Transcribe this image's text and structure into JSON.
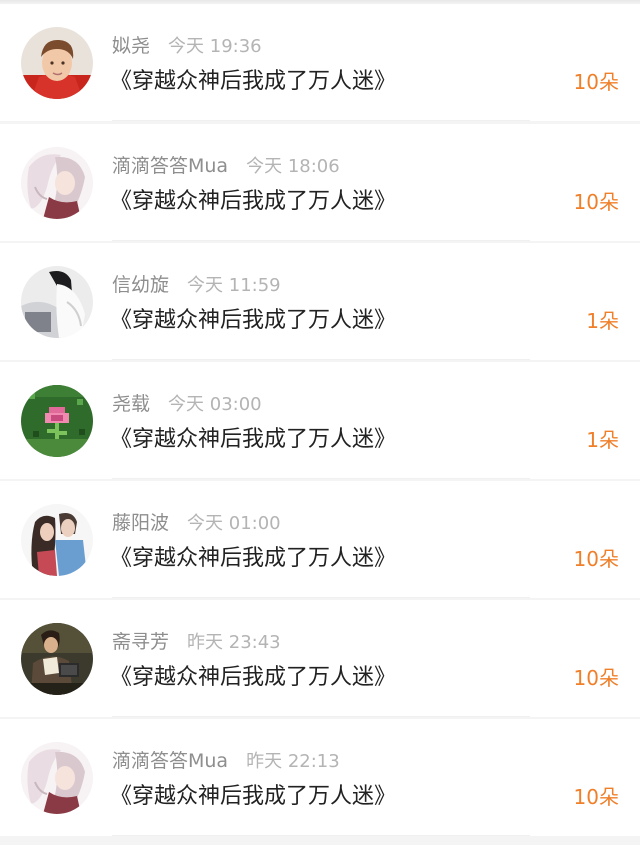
{
  "gifts": [
    {
      "name": "姒尧",
      "time": "今天 19:36",
      "title": "《穿越众神后我成了万人迷》",
      "count": "10朵",
      "avatar": "boy-red-jacket"
    },
    {
      "name": "滴滴答答Mua",
      "time": "今天 18:06",
      "title": "《穿越众神后我成了万人迷》",
      "count": "10朵",
      "avatar": "anime-couple"
    },
    {
      "name": "信幼旋",
      "time": "今天 11:59",
      "title": "《穿越众神后我成了万人迷》",
      "count": "1朵",
      "avatar": "girl-white-shirt"
    },
    {
      "name": "尧载",
      "time": "今天 03:00",
      "title": "《穿越众神后我成了万人迷》",
      "count": "1朵",
      "avatar": "pixel-flower"
    },
    {
      "name": "藤阳波",
      "time": "今天 01:00",
      "title": "《穿越众神后我成了万人迷》",
      "count": "10朵",
      "avatar": "couple-photo"
    },
    {
      "name": "斋寻芳",
      "time": "昨天 23:43",
      "title": "《穿越众神后我成了万人迷》",
      "count": "10朵",
      "avatar": "reader-book"
    },
    {
      "name": "滴滴答答Mua",
      "time": "昨天 22:13",
      "title": "《穿越众神后我成了万人迷》",
      "count": "10朵",
      "avatar": "anime-couple"
    }
  ],
  "colors": {
    "count": "#f07f2a",
    "name": "#8e8e8e",
    "time": "#b4b4b4",
    "title": "#222222",
    "background": "#f4f4f4"
  }
}
